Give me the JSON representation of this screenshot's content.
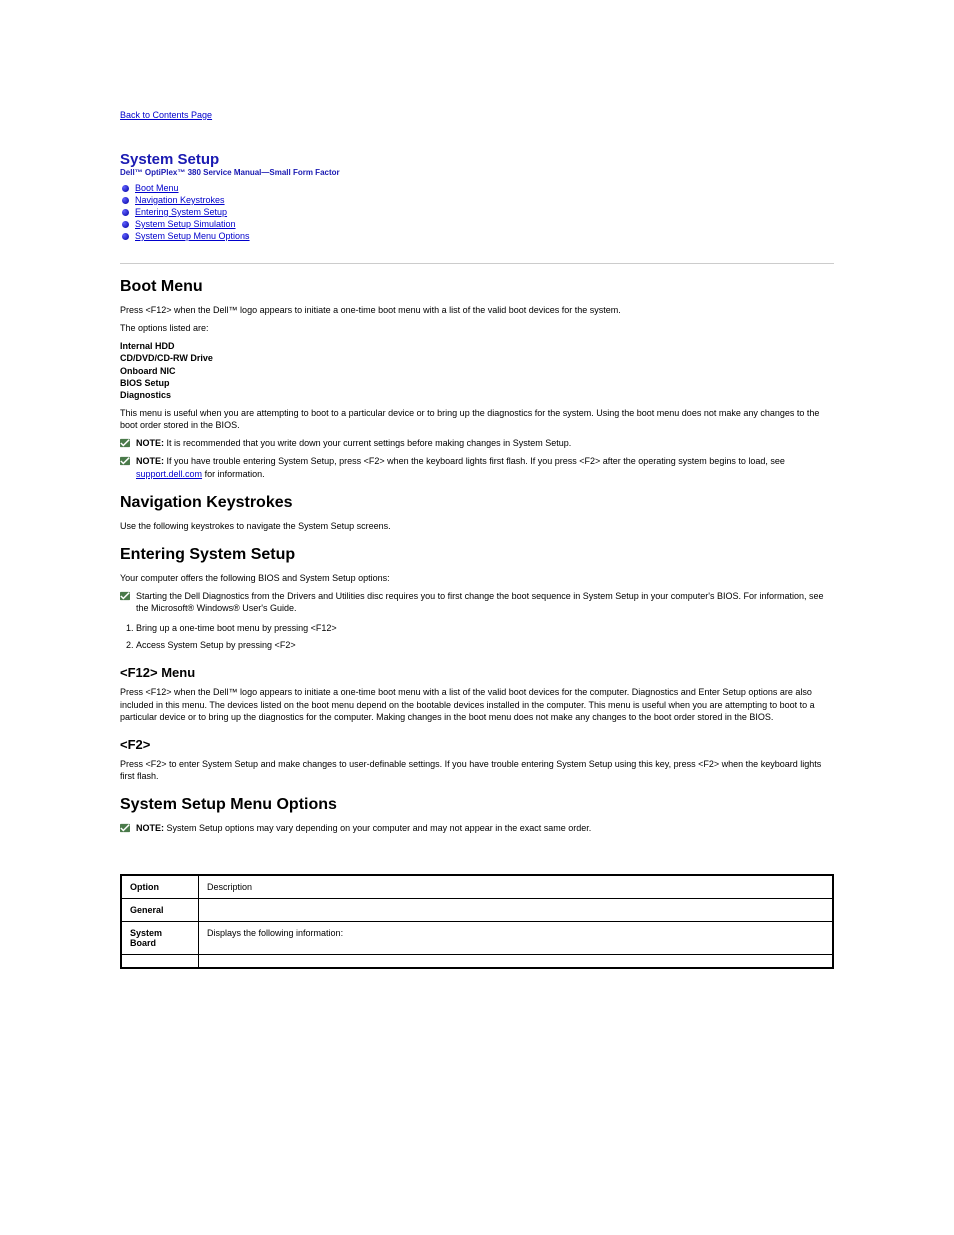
{
  "back_link": "Back to Contents Page",
  "doc_title_line1": "System Setup",
  "doc_title_line2": "Dell™ OptiPlex™ 380 Service Manual—Small Form Factor",
  "toc": {
    "items": [
      {
        "label": "Boot Menu"
      },
      {
        "label": "Navigation Keystrokes"
      },
      {
        "label": "Entering System Setup"
      },
      {
        "label": "System Setup Simulation"
      },
      {
        "label": "System Setup Menu Options"
      }
    ]
  },
  "sections": {
    "boot_menu": {
      "title": "Boot Menu",
      "p1": "Press <F12> when the Dell™ logo appears to initiate a one-time boot menu with a list of the valid boot devices for the system.",
      "p2": "The options listed are:",
      "options_list": "Internal HDD\nCD/DVD/CD-RW Drive\nOnboard NIC\nBIOS Setup\nDiagnostics",
      "p3": "This menu is useful when you are attempting to boot to a particular device or to bring up the diagnostics for the system. Using the boot menu does not make any changes to the boot order stored in the BIOS."
    },
    "nav_keys": {
      "title": "Navigation Keystrokes",
      "p1": "Use the following keystrokes to navigate the System Setup screens."
    },
    "enter_setup": {
      "title": "Entering System Setup",
      "p1": "Your computer offers the following BIOS and System Setup options:",
      "bullets": [
        "Bring up a one-time boot menu by pressing <F12>",
        "Access System Setup by pressing <F2>"
      ],
      "f12_title": "<F12> Menu",
      "f12_body": "Press <F12> when the Dell™ logo appears to initiate a one-time boot menu with a list of the valid boot devices for the computer. Diagnostics and Enter Setup options are also included in this menu. The devices listed on the boot menu depend on the bootable devices installed in the computer. This menu is useful when you are attempting to boot to a particular device or to bring up the diagnostics for the computer. Making changes in the boot menu does not make any changes to the boot order stored in the BIOS.",
      "f2_title": "<F2>",
      "f2_body_a": "Press <F2> to enter System Setup and make changes to user-definable settings. If you have trouble entering System Setup using this key, press <F2> when the keyboard lights first flash."
    },
    "menu_options": {
      "title": "System Setup Menu Options",
      "note_label": "NOTE:",
      "note_text": "System Setup options may vary depending on your computer and may not appear in the exact same order.",
      "table": [
        {
          "opt": "Option",
          "desc": "Description"
        },
        {
          "opt": "General",
          "desc": ""
        },
        {
          "opt": "System Board",
          "desc": "Displays the following information:"
        }
      ]
    }
  },
  "notes": {
    "note1_label": "NOTE:",
    "note1_text": "It is recommended that you write down your current settings before making changes in System Setup.",
    "note2_label": "NOTE:",
    "note2_text_a": "If you have trouble entering System Setup, press <F2> when the keyboard lights first flash. If you press <F2> after the operating system begins to load, see ",
    "note2_link": "support.dell.com",
    "note2_text_b": " for information."
  },
  "windows_note": "Starting the Dell Diagnostics from the Drivers and Utilities disc requires you to first change the boot sequence in System Setup in your computer's BIOS. For information, see the Microsoft® Windows® User's Guide."
}
